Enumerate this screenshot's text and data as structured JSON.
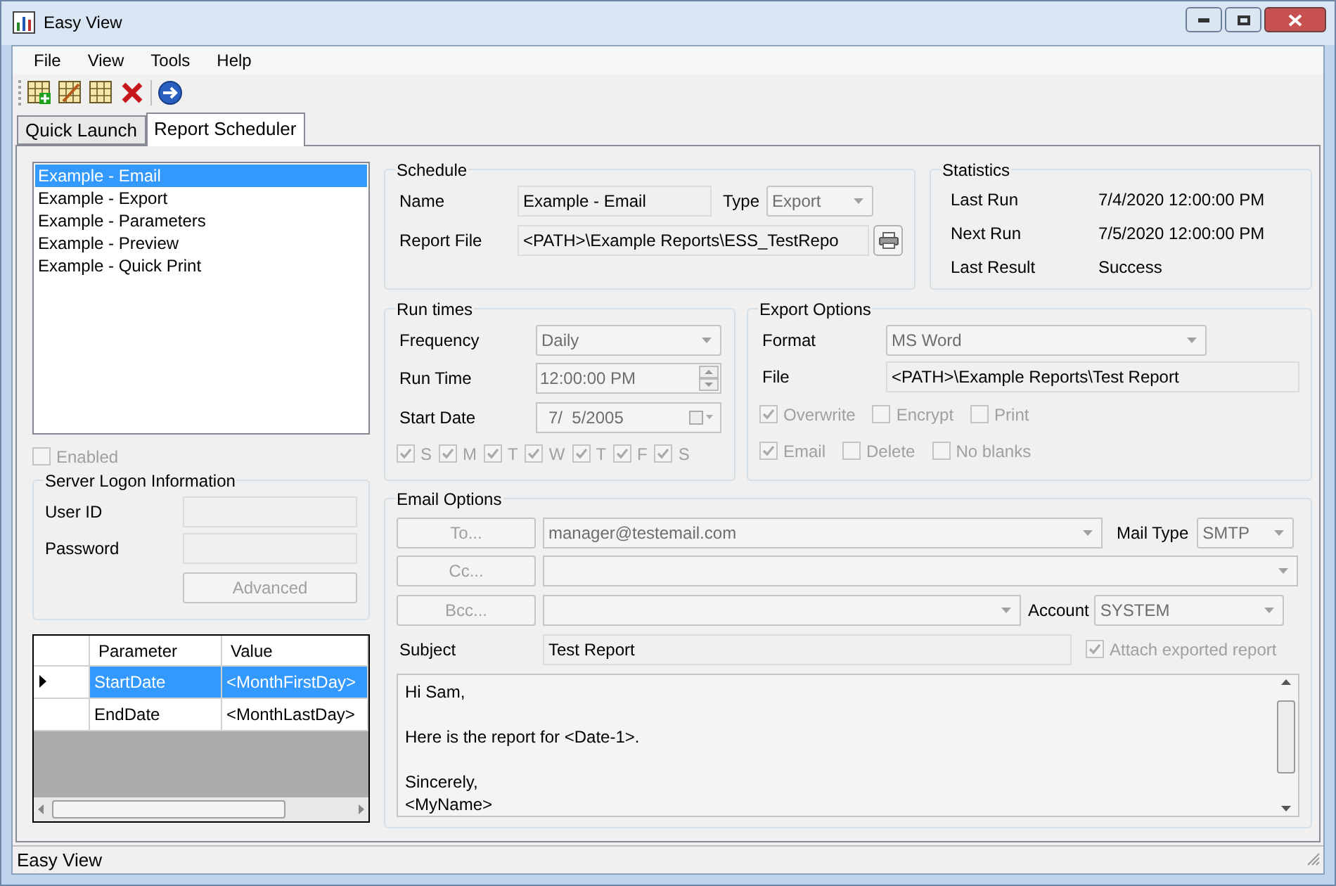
{
  "window": {
    "title": "Easy View"
  },
  "menu": [
    "File",
    "View",
    "Tools",
    "Help"
  ],
  "tabs": [
    {
      "label": "Quick Launch",
      "selected": false
    },
    {
      "label": "Report Scheduler",
      "selected": true
    }
  ],
  "schedules": [
    {
      "label": "Example - Email",
      "selected": true
    },
    {
      "label": "Example - Export",
      "selected": false
    },
    {
      "label": "Example - Parameters",
      "selected": false
    },
    {
      "label": "Example - Preview",
      "selected": false
    },
    {
      "label": "Example - Quick Print",
      "selected": false
    }
  ],
  "enabled": {
    "label": "Enabled",
    "checked": false
  },
  "server_logon": {
    "title": "Server Logon Information",
    "user_id_label": "User ID",
    "password_label": "Password",
    "advanced_button": "Advanced"
  },
  "parameters": {
    "columns": [
      "Parameter",
      "Value"
    ],
    "rows": [
      {
        "cells": [
          "StartDate",
          "<MonthFirstDay>"
        ],
        "selected": true
      },
      {
        "cells": [
          "EndDate",
          "<MonthLastDay>"
        ],
        "selected": false
      }
    ]
  },
  "schedule": {
    "title": "Schedule",
    "name_label": "Name",
    "name": "Example - Email",
    "type_label": "Type",
    "type": "Export",
    "report_file_label": "Report File",
    "report_file": "<PATH>\\Example Reports\\ESS_TestRepo"
  },
  "statistics": {
    "title": "Statistics",
    "rows": [
      {
        "label": "Last Run",
        "value": "7/4/2020 12:00:00 PM"
      },
      {
        "label": "Next Run",
        "value": "7/5/2020 12:00:00 PM"
      },
      {
        "label": "Last Result",
        "value": "Success"
      }
    ]
  },
  "run_times": {
    "title": "Run times",
    "frequency_label": "Frequency",
    "frequency": "Daily",
    "run_time_label": "Run Time",
    "run_time": "12:00:00 PM",
    "start_date_label": "Start Date",
    "start_date": "7/  5/2005",
    "days": [
      {
        "label": "S",
        "checked": true
      },
      {
        "label": "M",
        "checked": true
      },
      {
        "label": "T",
        "checked": true
      },
      {
        "label": "W",
        "checked": true
      },
      {
        "label": "T",
        "checked": true
      },
      {
        "label": "F",
        "checked": true
      },
      {
        "label": "S",
        "checked": true
      }
    ]
  },
  "export_options": {
    "title": "Export Options",
    "format_label": "Format",
    "format": "MS Word",
    "file_label": "File",
    "file": "<PATH>\\Example Reports\\Test Report",
    "options": [
      [
        {
          "label": "Overwrite",
          "checked": true
        },
        {
          "label": "Encrypt",
          "checked": false
        },
        {
          "label": "Print",
          "checked": false
        }
      ],
      [
        {
          "label": "Email",
          "checked": true
        },
        {
          "label": "Delete",
          "checked": false
        },
        {
          "label": "No blanks",
          "checked": false
        }
      ]
    ]
  },
  "email_options": {
    "title": "Email Options",
    "to_button": "To...",
    "to": "manager@testemail.com",
    "mail_type_label": "Mail Type",
    "mail_type": "SMTP",
    "cc_button": "Cc...",
    "bcc_button": "Bcc...",
    "account_label": "Account",
    "account": "SYSTEM",
    "subject_label": "Subject",
    "subject": "Test Report",
    "attach": {
      "label": "Attach exported report",
      "checked": true
    },
    "body": "Hi Sam,\n\nHere is the report for <Date-1>.\n\nSincerely,\n<MyName>"
  },
  "status_bar": "Easy View"
}
